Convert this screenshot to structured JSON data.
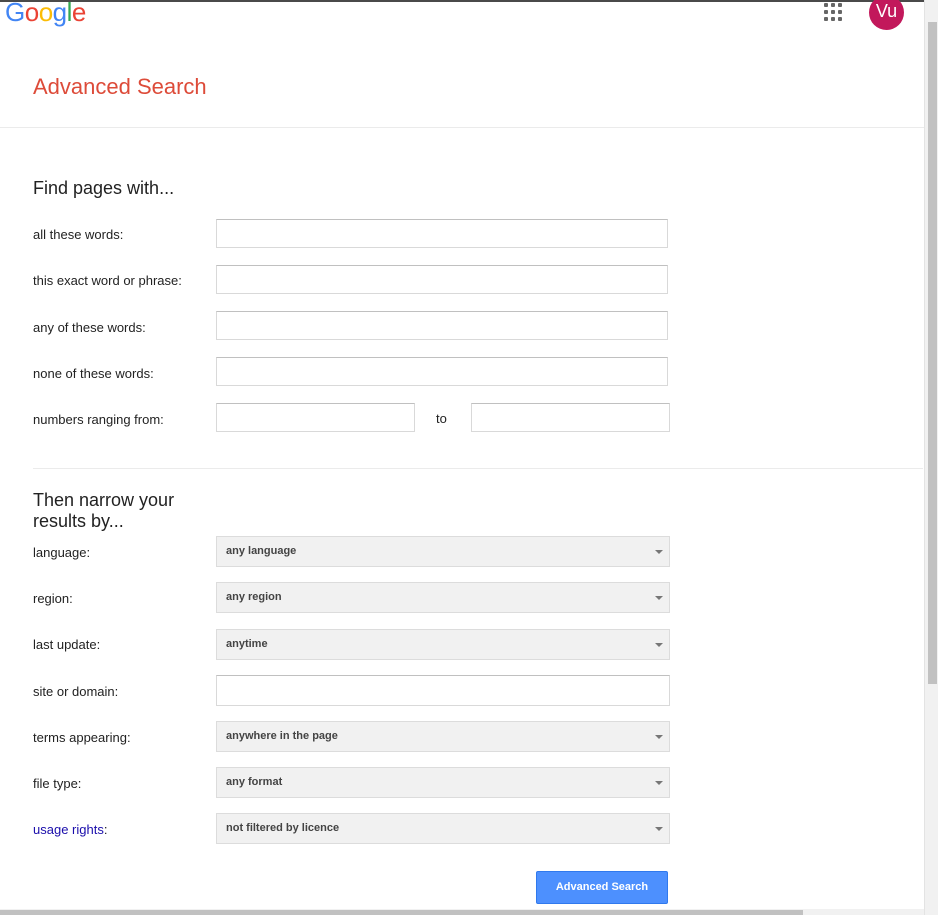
{
  "header": {
    "logo": [
      "G",
      "o",
      "o",
      "g",
      "l",
      "e"
    ],
    "logo_colors": [
      "#4285f4",
      "#ea4335",
      "#fbbc05",
      "#4285f4",
      "#34a853",
      "#ea4335"
    ],
    "apps_icon": "apps-grid-icon",
    "avatar_initials": "Vu",
    "avatar_color": "#c2185b"
  },
  "page_title": "Advanced Search",
  "find_section": {
    "title": "Find pages with...",
    "fields": [
      {
        "label": "all these words:",
        "value": ""
      },
      {
        "label": "this exact word or phrase:",
        "value": ""
      },
      {
        "label": "any of these words:",
        "value": ""
      },
      {
        "label": "none of these words:",
        "value": ""
      }
    ],
    "numbers": {
      "label": "numbers ranging from:",
      "from": "",
      "to_label": "to",
      "to": ""
    }
  },
  "narrow_section": {
    "title_line1": "Then narrow your",
    "title_line2": "results by...",
    "language": {
      "label": "language:",
      "value": "any language"
    },
    "region": {
      "label": "region:",
      "value": "any region"
    },
    "last_update": {
      "label": "last update:",
      "value": "anytime"
    },
    "site": {
      "label": "site or domain:",
      "value": ""
    },
    "terms": {
      "label": "terms appearing:",
      "value": "anywhere in the page"
    },
    "file_type": {
      "label": "file type:",
      "value": "any format"
    },
    "usage_rights": {
      "label_link": "usage rights",
      "label_suffix": ":",
      "value": "not filtered by licence"
    }
  },
  "submit_label": "Advanced Search",
  "colors": {
    "title_red": "#dd4b39",
    "button_blue": "#4d90fe",
    "link_blue": "#1a0dab"
  }
}
